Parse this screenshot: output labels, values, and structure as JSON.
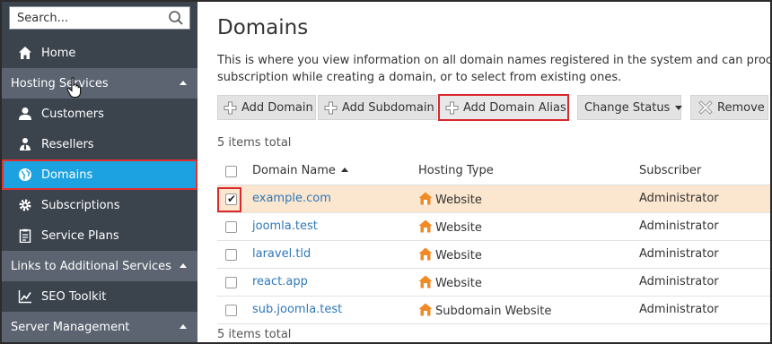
{
  "sidebar": {
    "search_placeholder": "Search...",
    "items": [
      {
        "label": "Home"
      },
      {
        "label": "Customers"
      },
      {
        "label": "Resellers"
      },
      {
        "label": "Domains"
      },
      {
        "label": "Subscriptions"
      },
      {
        "label": "Service Plans"
      },
      {
        "label": "SEO Toolkit"
      }
    ],
    "sections": [
      {
        "label": "Hosting Services"
      },
      {
        "label": "Links to Additional Services"
      },
      {
        "label": "Server Management"
      }
    ],
    "active_color": "#1ca2e0"
  },
  "main": {
    "title": "Domains",
    "description_line1": "This is where you view information on all domain names registered in the system and can proceed to r",
    "description_line2": "subscription while creating a domain, or to select from existing ones.",
    "toolbar": {
      "add_domain": "Add Domain",
      "add_subdomain": "Add Subdomain",
      "add_domain_alias": "Add Domain Alias",
      "change_status": "Change Status",
      "remove": "Remove"
    },
    "items_total_top": "5 items total",
    "items_total_bottom": "5 items total",
    "columns": {
      "domain_name": "Domain Name",
      "hosting_type": "Hosting Type",
      "subscriber": "Subscriber"
    },
    "rows": [
      {
        "domain": "example.com",
        "hosting": "Website",
        "subscriber": "Administrator",
        "checked": true
      },
      {
        "domain": "joomla.test",
        "hosting": "Website",
        "subscriber": "Administrator",
        "checked": false
      },
      {
        "domain": "laravel.tld",
        "hosting": "Website",
        "subscriber": "Administrator",
        "checked": false
      },
      {
        "domain": "react.app",
        "hosting": "Website",
        "subscriber": "Administrator",
        "checked": false
      },
      {
        "domain": "sub.joomla.test",
        "hosting": "Subdomain Website",
        "subscriber": "Administrator",
        "checked": false
      }
    ]
  }
}
